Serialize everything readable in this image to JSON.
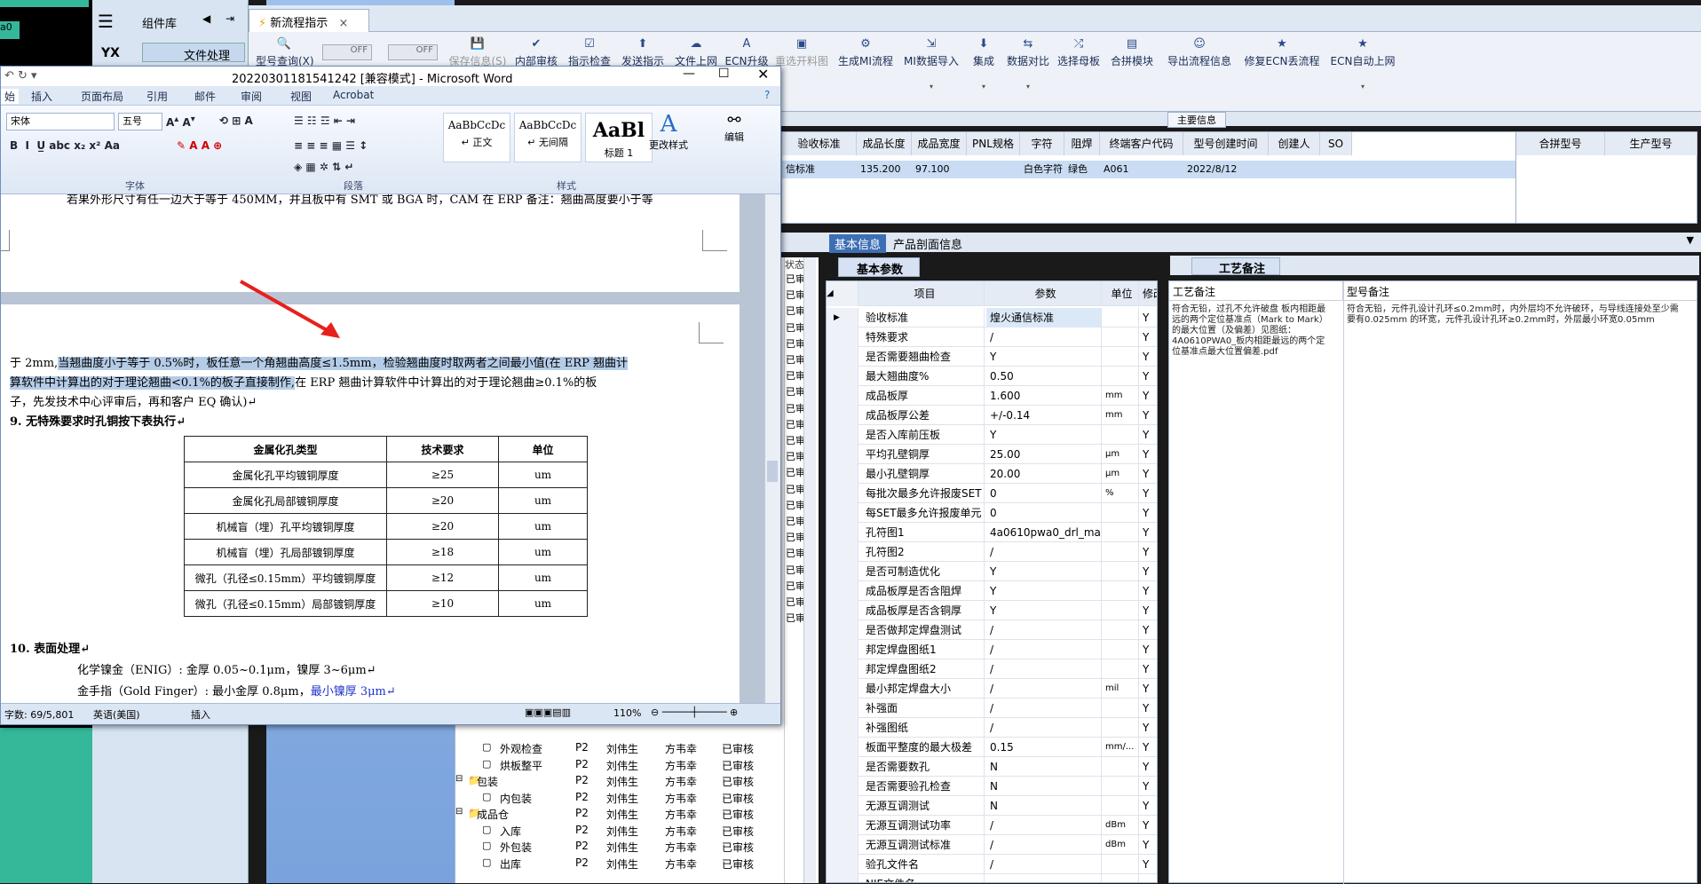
{
  "erp": {
    "sidebar_title": "组件库",
    "sidebar_item": "文件处理",
    "logo": "YX",
    "tab_title": "新流程指示",
    "toolbar": [
      {
        "label": "型号查询(X)",
        "icon": "search-icon",
        "disabled": false
      },
      {
        "label": "OFF",
        "icon": "toggle-icon",
        "disabled": false
      },
      {
        "label": "OFF",
        "icon": "toggle-icon",
        "disabled": false
      },
      {
        "label": "保存信息(S)",
        "icon": "save-icon",
        "disabled": true
      },
      {
        "label": "内部审核",
        "icon": "check-icon",
        "disabled": false
      },
      {
        "label": "指示检查",
        "icon": "checkbox-icon",
        "disabled": false
      },
      {
        "label": "发送指示",
        "icon": "upload-icon",
        "disabled": false
      },
      {
        "label": "文件上网",
        "icon": "cloud-icon",
        "disabled": false
      },
      {
        "label": "ECN升级",
        "icon": "a-icon",
        "disabled": false
      },
      {
        "label": "重选开料图",
        "icon": "image-icon",
        "disabled": true
      },
      {
        "label": "生成MI流程",
        "icon": "gear-icon",
        "disabled": false
      },
      {
        "label": "MI数据导入",
        "icon": "import-icon",
        "disabled": false
      },
      {
        "label": "集成",
        "icon": "download-icon",
        "disabled": false
      },
      {
        "label": "数据对比",
        "icon": "compare-icon",
        "disabled": false
      },
      {
        "label": "选择母板",
        "icon": "shuffle-icon",
        "disabled": false
      },
      {
        "label": "合拼模块",
        "icon": "merge-icon",
        "disabled": false
      },
      {
        "label": "导出流程信息",
        "icon": "smile-icon",
        "disabled": false
      },
      {
        "label": "修复ECN丢流程",
        "icon": "star-icon",
        "disabled": false
      },
      {
        "label": "ECN自动上网",
        "icon": "star-icon",
        "disabled": false
      }
    ],
    "main_info_label": "主要信息",
    "top_grid_headers": [
      "验收标准",
      "成品长度",
      "成品宽度",
      "PNL规格",
      "字符",
      "阻焊",
      "终端客户代码",
      "型号创建时间",
      "创建人",
      "SO"
    ],
    "top_grid_row": [
      "信标准",
      "135.200",
      "97.100",
      "",
      "白色字符",
      "绿色",
      "A061",
      "2022/8/12",
      "",
      ""
    ],
    "merge_headers": [
      "合拼型号",
      "生产型号"
    ],
    "info_tabs": [
      "基本信息",
      "产品剖面信息"
    ],
    "basic_params_tab": "基本参数",
    "craft_tab": "工艺备注",
    "param_headers": [
      "项目",
      "参数",
      "单位",
      "修改"
    ],
    "params": [
      [
        "验收标准",
        "煌火通信标准",
        "",
        "Y"
      ],
      [
        "特殊要求",
        "/",
        "",
        "Y"
      ],
      [
        "是否需要翘曲检查",
        "Y",
        "",
        "Y"
      ],
      [
        "最大翘曲度%",
        "0.50",
        "",
        "Y"
      ],
      [
        "成品板厚",
        "1.600",
        "mm",
        "Y"
      ],
      [
        "成品板厚公差",
        "+/-0.14",
        "mm",
        "Y"
      ],
      [
        "是否入库前压板",
        "Y",
        "",
        "Y"
      ],
      [
        "平均孔壁铜厚",
        "25.00",
        "μm",
        "Y"
      ],
      [
        "最小孔壁铜厚",
        "20.00",
        "μm",
        "Y"
      ],
      [
        "每批次最多允许报废SET",
        "0",
        "%",
        "Y"
      ],
      [
        "每SET最多允许报废单元",
        "0",
        "",
        "Y"
      ],
      [
        "孔符图1",
        "4a0610pwa0_drl_ma...",
        "",
        "Y"
      ],
      [
        "孔符图2",
        "/",
        "",
        "Y"
      ],
      [
        "是否可制造优化",
        "Y",
        "",
        "Y"
      ],
      [
        "成品板厚是否含阻焊",
        "Y",
        "",
        "Y"
      ],
      [
        "成品板厚是否含铜厚",
        "Y",
        "",
        "Y"
      ],
      [
        "是否做邦定焊盘测试",
        "/",
        "",
        "Y"
      ],
      [
        "邦定焊盘图纸1",
        "/",
        "",
        "Y"
      ],
      [
        "邦定焊盘图纸2",
        "/",
        "",
        "Y"
      ],
      [
        "最小邦定焊盘大小",
        "/",
        "mil",
        "Y"
      ],
      [
        "补强面",
        "/",
        "",
        "Y"
      ],
      [
        "补强图纸",
        "/",
        "",
        "Y"
      ],
      [
        "板面平整度的最大极差",
        "0.15",
        "mm/...",
        "Y"
      ],
      [
        "是否需要数孔",
        "N",
        "",
        "Y"
      ],
      [
        "是否需要验孔检查",
        "N",
        "",
        "Y"
      ],
      [
        "无源互调测试",
        "N",
        "",
        "Y"
      ],
      [
        "无源互调测试功率",
        "/",
        "dBm",
        "Y"
      ],
      [
        "无源互调测试标准",
        "/",
        "dBm",
        "Y"
      ],
      [
        "验孔文件名",
        "/",
        "",
        "Y"
      ],
      [
        "NJE文件名",
        "",
        "",
        ""
      ]
    ],
    "craft_headers": [
      "工艺备注",
      "型号备注"
    ],
    "craft_note": "符合无铅，过孔不允许破盘 板内相距最远的两个定位基准点（Mark to Mark）的最大位置（及偏差）见图纸：4A0610PWA0_板内相距最远的两个定位基准点最大位置偏差.pdf",
    "model_note": "符合无铅，元件孔设计孔环≤0.2mm时，内外层均不允许破环，与导线连接处至少需要有0.025mm 的环宽，元件孔设计孔环≥0.2mm时，外层最小环宽0.05mm",
    "tree_rows": [
      {
        "name": "外观检查",
        "code": "P2",
        "a": "刘伟生",
        "b": "方韦幸",
        "st": "已审核",
        "lvl": 2,
        "folder": false
      },
      {
        "name": "烘板整平",
        "code": "P2",
        "a": "刘伟生",
        "b": "方韦幸",
        "st": "已审核",
        "lvl": 2,
        "folder": false
      },
      {
        "name": "包装",
        "code": "P2",
        "a": "刘伟生",
        "b": "方韦幸",
        "st": "已审核",
        "lvl": 1,
        "folder": true
      },
      {
        "name": "内包装",
        "code": "P2",
        "a": "刘伟生",
        "b": "方韦幸",
        "st": "已审核",
        "lvl": 2,
        "folder": false
      },
      {
        "name": "成品仓",
        "code": "P2",
        "a": "刘伟生",
        "b": "方韦幸",
        "st": "已审核",
        "lvl": 1,
        "folder": true
      },
      {
        "name": "入库",
        "code": "P2",
        "a": "刘伟生",
        "b": "方韦幸",
        "st": "已审核",
        "lvl": 2,
        "folder": false
      },
      {
        "name": "外包装",
        "code": "P2",
        "a": "刘伟生",
        "b": "方韦幸",
        "st": "已审核",
        "lvl": 2,
        "folder": false
      },
      {
        "name": "出库",
        "code": "P2",
        "a": "刘伟生",
        "b": "方韦幸",
        "st": "已审核",
        "lvl": 2,
        "folder": false
      }
    ],
    "status_col_header": "状态",
    "status_col_value": "已审核"
  },
  "word": {
    "title": "20220301181541242 [兼容模式] - Microsoft Word",
    "tabs": [
      "始",
      "插入",
      "页面布局",
      "引用",
      "邮件",
      "审阅",
      "视图",
      "Acrobat"
    ],
    "font_name": "宋体",
    "font_size": "五号",
    "styles": [
      {
        "preview": "AaBbCcDc",
        "name": "↵ 正文"
      },
      {
        "preview": "AaBbCcDc",
        "name": "↵ 无间隔"
      },
      {
        "preview": "AaBl",
        "name": "标题 1"
      }
    ],
    "change_styles": "更改样式",
    "edit": "编辑",
    "group_font": "字体",
    "group_para": "段落",
    "group_style": "样式",
    "doc_line1": "若果外形尺寸有任一边大于等于 450MM，并且板中有 SMT 或 BGA 时，CAM 在 ERP 备注：翘曲高度要小于等",
    "p2_line1_a": "于 2mm,",
    "p2_line1_b": "当翘曲度小于等于 0.5%时，板任意一个角翘曲高度≤1.5mm，检验翘曲度时取两者之间最小值(在 ERP 翘曲计",
    "p2_line2_a": "算软件中计算出的对于理论翘曲<0.1%的板子直接制作,",
    "p2_line2_b": "在 ERP 翘曲计算软件中计算出的对于理论翘曲≥0.1%的板",
    "p2_line3": "子，先发技术中心评审后，再和客户 EQ 确认)↵",
    "heading9": "9. 无特殊要求时孔铜按下表执行↵",
    "table_headers": [
      "金属化孔类型",
      "技术要求",
      "单位"
    ],
    "table_rows": [
      [
        "金属化孔平均镀铜厚度",
        "≥25",
        "um"
      ],
      [
        "金属化孔局部镀铜厚度",
        "≥20",
        "um"
      ],
      [
        "机械盲（埋）孔平均镀铜厚度",
        "≥20",
        "um"
      ],
      [
        "机械盲（埋）孔局部镀铜厚度",
        "≥18",
        "um"
      ],
      [
        "微孔（孔径≤0.15mm）平均镀铜厚度",
        "≥12",
        "um"
      ],
      [
        "微孔（孔径≤0.15mm）局部镀铜厚度",
        "≥10",
        "um"
      ]
    ],
    "heading10": "10. 表面处理↵",
    "enig": "化学镍金（ENIG）: 金厚 0.05~0.1μm，镍厚 3~6μm↵",
    "gold": "金手指（Gold Finger）: 最小金厚 0.8μm，",
    "gold_blue": "最小镍厚 3μm↵",
    "status_words": "字数: 69/5,801",
    "status_lang": "英语(美国)",
    "status_insert": "插入",
    "zoom": "110%"
  }
}
